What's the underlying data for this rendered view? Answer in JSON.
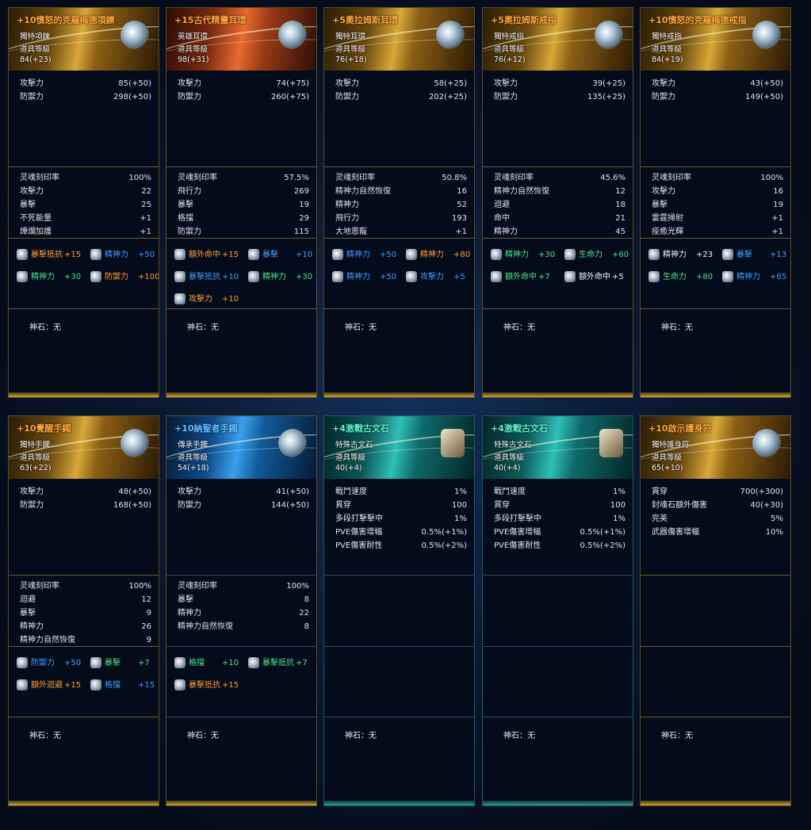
{
  "shen_label": "神石：无",
  "cards": [
    {
      "title": "+10憤怒的克羅梅德項鍊",
      "title_color": "orange",
      "hdr": "gold",
      "lines": [
        "獨特項鍊",
        "道具等級",
        "84(+23)"
      ],
      "icon": "necklace-icon",
      "base": [
        [
          "攻擊力",
          "85(+50)"
        ],
        [
          "防禦力",
          "298(+50)"
        ]
      ],
      "stats": [
        [
          "灵魂刻印率",
          "100%"
        ],
        [
          "攻擊力",
          "22"
        ],
        [
          "暴擊",
          "25"
        ],
        [
          "不死能量",
          "+1"
        ],
        [
          "燁爛加護",
          "+1"
        ]
      ],
      "gems": [
        [
          "暴擊抵抗",
          "+15",
          "orange"
        ],
        [
          "精神力",
          "+50",
          "blue"
        ],
        [
          "精神力",
          "+30",
          "green"
        ],
        [
          "防禦力",
          "+100",
          "orange"
        ]
      ]
    },
    {
      "title": "+15古代精靈耳環",
      "title_color": "orange",
      "hdr": "red",
      "lines": [
        "英雄耳環",
        "道具等級",
        "98(+31)"
      ],
      "icon": "earring-icon",
      "base": [
        [
          "攻擊力",
          "74(+75)"
        ],
        [
          "防禦力",
          "260(+75)"
        ]
      ],
      "stats": [
        [
          "灵魂刻印率",
          "57.5%"
        ],
        [
          "飛行力",
          "269"
        ],
        [
          "暴擊",
          "19"
        ],
        [
          "格擋",
          "29"
        ],
        [
          "防禦力",
          "115"
        ]
      ],
      "gems": [
        [
          "額外命中",
          "+15",
          "orange"
        ],
        [
          "暴擊",
          "+10",
          "blue"
        ],
        [
          "暴擊抵抗",
          "+10",
          "blue"
        ],
        [
          "精神力",
          "+30",
          "green"
        ],
        [
          "攻擊力",
          "+10",
          "orange"
        ]
      ]
    },
    {
      "title": "+5奧拉姆斯耳環",
      "title_color": "orange",
      "hdr": "gold",
      "lines": [
        "獨特耳環",
        "道具等級",
        "76(+18)"
      ],
      "icon": "earring-icon",
      "base": [
        [
          "攻擊力",
          "58(+25)"
        ],
        [
          "防禦力",
          "202(+25)"
        ]
      ],
      "stats": [
        [
          "灵魂刻印率",
          "50.8%"
        ],
        [
          "精神力自然恢復",
          "16"
        ],
        [
          "精神力",
          "52"
        ],
        [
          "飛行力",
          "193"
        ],
        [
          "大地恩寵",
          "+1"
        ]
      ],
      "gems": [
        [
          "精神力",
          "+50",
          "blue"
        ],
        [
          "精神力",
          "+80",
          "orange"
        ],
        [
          "精神力",
          "+50",
          "blue"
        ],
        [
          "攻擊力",
          "+5",
          "blue"
        ]
      ]
    },
    {
      "title": "+5奧拉姆斯戒指",
      "title_color": "orange",
      "hdr": "gold",
      "lines": [
        "獨特戒指",
        "道具等級",
        "76(+12)"
      ],
      "icon": "ring-icon",
      "base": [
        [
          "攻擊力",
          "39(+25)"
        ],
        [
          "防禦力",
          "135(+25)"
        ]
      ],
      "stats": [
        [
          "灵魂刻印率",
          "45.6%"
        ],
        [
          "精神力自然恢復",
          "12"
        ],
        [
          "迴避",
          "18"
        ],
        [
          "命中",
          "21"
        ],
        [
          "精神力",
          "45"
        ]
      ],
      "gems": [
        [
          "精神力",
          "+30",
          "green"
        ],
        [
          "生命力",
          "+60",
          "green"
        ],
        [
          "額外命中",
          "+7",
          "green"
        ],
        [
          "額外命中",
          "+5",
          "white"
        ]
      ]
    },
    {
      "title": "+10憤怒的克羅梅德戒指",
      "title_color": "orange",
      "hdr": "gold",
      "lines": [
        "獨特戒指",
        "道具等級",
        "84(+19)"
      ],
      "icon": "ring-icon",
      "base": [
        [
          "攻擊力",
          "43(+50)"
        ],
        [
          "防禦力",
          "149(+50)"
        ]
      ],
      "stats": [
        [
          "灵魂刻印率",
          "100%"
        ],
        [
          "攻擊力",
          "16"
        ],
        [
          "暴擊",
          "19"
        ],
        [
          "雷霆掃射",
          "+1"
        ],
        [
          "痊癒光輝",
          "+1"
        ]
      ],
      "gems": [
        [
          "精神力",
          "+23",
          "white"
        ],
        [
          "暴擊",
          "+13",
          "blue"
        ],
        [
          "生命力",
          "+80",
          "green"
        ],
        [
          "精神力",
          "+65",
          "blue"
        ]
      ]
    },
    {
      "title": "+10覺醒手鐲",
      "title_color": "orange",
      "hdr": "gold",
      "lines": [
        "獨特手鐲",
        "道具等級",
        "63(+22)"
      ],
      "icon": "bracelet-icon",
      "base": [
        [
          "攻擊力",
          "48(+50)"
        ],
        [
          "防禦力",
          "168(+50)"
        ]
      ],
      "stats": [
        [
          "灵魂刻印率",
          "100%"
        ],
        [
          "迴避",
          "12"
        ],
        [
          "暴擊",
          "9"
        ],
        [
          "精神力",
          "26"
        ],
        [
          "精神力自然恢復",
          "9"
        ]
      ],
      "gems": [
        [
          "防禦力",
          "+50",
          "blue"
        ],
        [
          "暴擊",
          "+7",
          "green"
        ],
        [
          "額外迴避",
          "+15",
          "orange"
        ],
        [
          "格擋",
          "+15",
          "blue"
        ]
      ]
    },
    {
      "title": "+10納聖者手鐲",
      "title_color": "blue",
      "hdr": "blue",
      "lines": [
        "傳承手鐲",
        "道具等級",
        "54(+18)"
      ],
      "icon": "bracelet-icon",
      "base": [
        [
          "攻擊力",
          "41(+50)"
        ],
        [
          "防禦力",
          "144(+50)"
        ]
      ],
      "stats": [
        [
          "灵魂刻印率",
          "100%"
        ],
        [
          "暴擊",
          "8"
        ],
        [
          "精神力",
          "22"
        ],
        [
          "精神力自然恢復",
          "8"
        ]
      ],
      "gems": [
        [
          "格擋",
          "+10",
          "green"
        ],
        [
          "暴擊抵抗",
          "+7",
          "green"
        ],
        [
          "暴擊抵抗",
          "+15",
          "orange"
        ]
      ]
    },
    {
      "title": "+4激戰古文石",
      "title_color": "teal",
      "hdr": "teal",
      "lines": [
        "特殊古文石",
        "道具等級",
        "40(+4)"
      ],
      "icon": "rune-icon",
      "base": [
        [
          "戰鬥速度",
          "1%"
        ],
        [
          "貫穿",
          "100"
        ],
        [
          "多段打擊擊中",
          "1%"
        ],
        [
          "PVE傷害增幅",
          "0.5%(+1%)"
        ],
        [
          "PVE傷害耐性",
          "0.5%(+2%)"
        ]
      ],
      "stats": [],
      "gems": []
    },
    {
      "title": "+4激戰古文石",
      "title_color": "teal",
      "hdr": "teal",
      "lines": [
        "特殊古文石",
        "道具等級",
        "40(+4)"
      ],
      "icon": "rune-icon",
      "base": [
        [
          "戰鬥速度",
          "1%"
        ],
        [
          "貫穿",
          "100"
        ],
        [
          "多段打擊擊中",
          "1%"
        ],
        [
          "PVE傷害增幅",
          "0.5%(+1%)"
        ],
        [
          "PVE傷害耐性",
          "0.5%(+2%)"
        ]
      ],
      "stats": [],
      "gems": []
    },
    {
      "title": "+10啟示護身符",
      "title_color": "orange",
      "hdr": "gold",
      "lines": [
        "獨特護身符",
        "道具等級",
        "65(+10)"
      ],
      "icon": "amulet-icon",
      "base": [
        [
          "貫穿",
          "700(+300)"
        ],
        [
          "封魂石額外傷害",
          "40(+30)"
        ],
        [
          "完美",
          "5%"
        ],
        [
          "武器傷害增幅",
          "10%"
        ]
      ],
      "stats": [],
      "gems": []
    }
  ]
}
